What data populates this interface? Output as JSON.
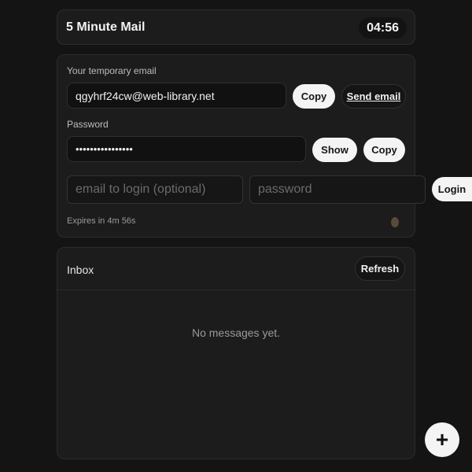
{
  "header": {
    "title": "5 Minute Mail",
    "timer": "04:56"
  },
  "email_section": {
    "label": "Your temporary email",
    "value": "qgyhrf24cw@web-library.net",
    "copy_label": "Copy",
    "send_label": "Send email"
  },
  "password_section": {
    "label": "Password",
    "value": "••••••••••••••••",
    "show_label": "Show",
    "copy_label": "Copy"
  },
  "login": {
    "email_placeholder": "email to login (optional)",
    "password_placeholder": "password",
    "login_label": "Login"
  },
  "expires_text": "Expires in 4m 56s",
  "inbox": {
    "title": "Inbox",
    "refresh_label": "Refresh",
    "empty_text": "No messages yet."
  },
  "fab": {
    "label": "+"
  }
}
